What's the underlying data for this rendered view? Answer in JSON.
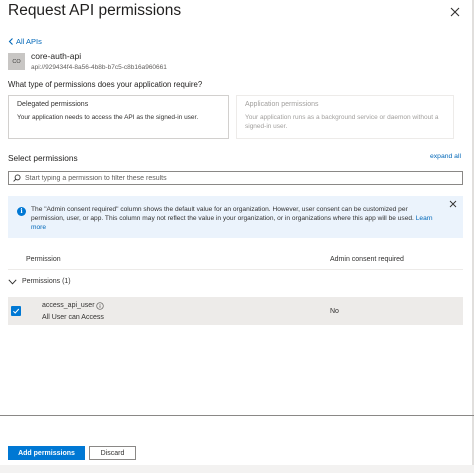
{
  "panel": {
    "title": "Request API permissions",
    "back_label": "All APIs"
  },
  "api": {
    "avatar_initials": "CO",
    "name": "core-auth-api",
    "uri": "api://929434f4-8a56-4b8b-b7c5-c8b16a960661"
  },
  "permission_type": {
    "question": "What type of permissions does your application require?",
    "delegated": {
      "title": "Delegated permissions",
      "description": "Your application needs to access the API as the signed-in user."
    },
    "application": {
      "title": "Application permissions",
      "description": "Your application runs as a background service or daemon without a signed-in user."
    }
  },
  "select": {
    "label": "Select permissions",
    "expand_all": "expand all",
    "search_placeholder": "Start typing a permission to filter these results"
  },
  "info_banner": {
    "text": "The \"Admin consent required\" column shows the default value for an organization. However, user consent can be customized per permission, user, or app. This column may not reflect the value in your organization, or in organizations where this app will be used.",
    "link": "Learn more"
  },
  "table": {
    "columns": [
      "Permission",
      "Admin consent required"
    ],
    "group_label": "Permissions (1)",
    "rows": [
      {
        "name": "access_api_user",
        "description": "All User can Access",
        "admin_consent": "No",
        "checked": true
      }
    ]
  },
  "footer": {
    "add_label": "Add permissions",
    "discard_label": "Discard"
  },
  "colors": {
    "accent": "#0078d4",
    "link": "#0067b8",
    "info_bg": "#ebf3fc"
  }
}
